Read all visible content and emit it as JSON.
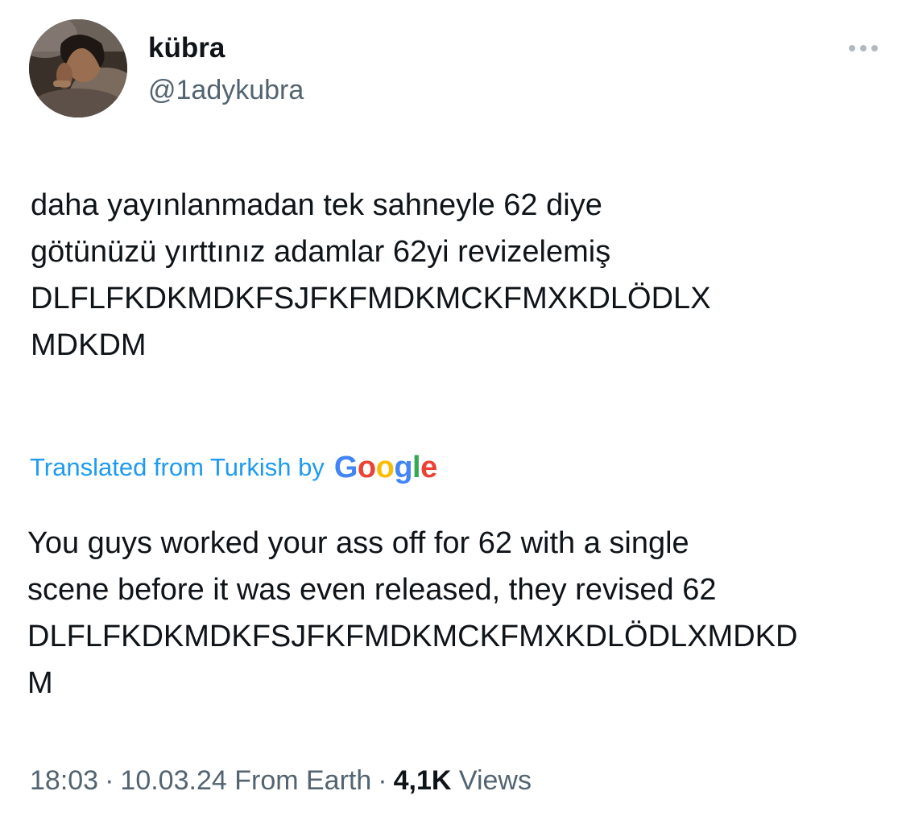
{
  "author": {
    "display_name": "kübra",
    "handle": "@1adykubra"
  },
  "tweet": {
    "text": "daha yayınlanmadan tek sahneyle 62 diye\ngötünüzü yırttınız adamlar 62yi revizelemiş\nDLFLFKDKMDKFSJFKFMDKMCKFMXKDLÖDLX\nMDKDM"
  },
  "translation": {
    "label": "Translated from Turkish by",
    "provider": "Google",
    "text": "You guys worked your ass off for 62 with a single\nscene before it was even released, they revised 62\nDLFLFKDKMDKFSJFKFMDKMCKFMXKDLÖDLXMDKD\nM"
  },
  "meta": {
    "time": "18:03",
    "date": "10.03.24",
    "source": "From Earth",
    "views_count": "4,1K",
    "views_label": "Views"
  },
  "colors": {
    "link": "#1d9bf0",
    "secondary_text": "#536471",
    "primary_text": "#0f1419"
  },
  "icons": {
    "more": "more-horizontal-icon"
  }
}
